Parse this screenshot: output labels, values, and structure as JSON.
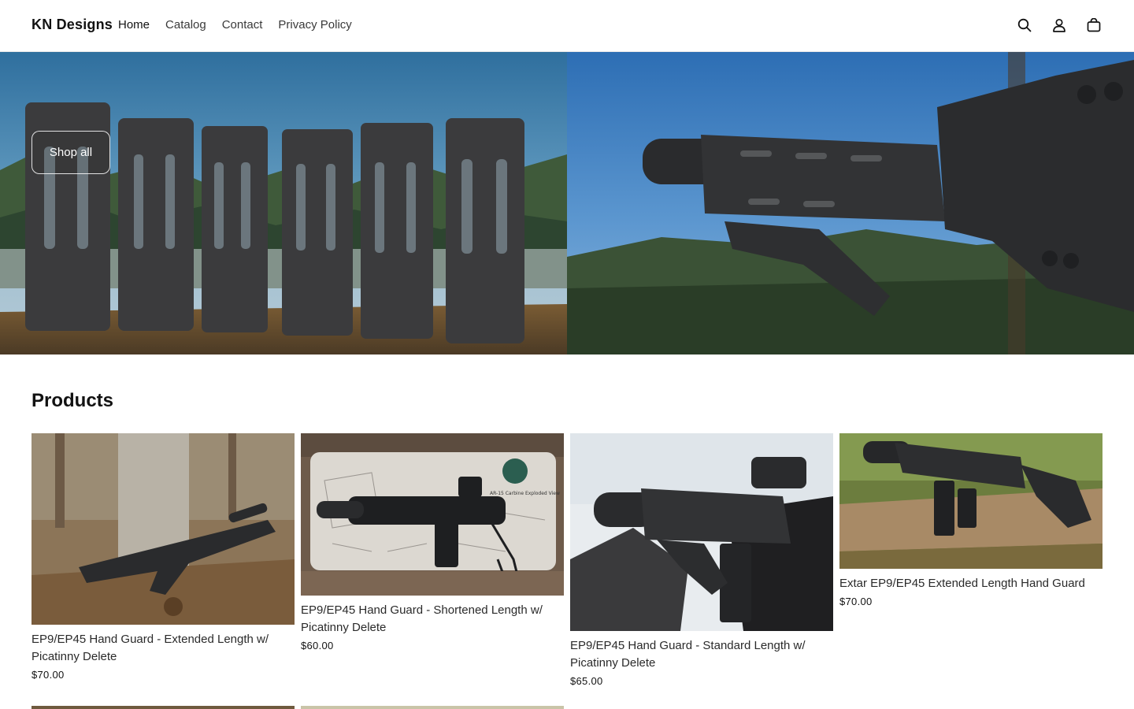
{
  "header": {
    "brand": "KN Designs",
    "nav": [
      {
        "label": "Home",
        "active": true
      },
      {
        "label": "Catalog"
      },
      {
        "label": "Contact"
      },
      {
        "label": "Privacy Policy"
      }
    ],
    "icons": [
      "search-icon",
      "account-icon",
      "cart-icon"
    ]
  },
  "hero": {
    "button": "Shop all"
  },
  "products": {
    "title": "Products",
    "items": [
      {
        "title": "EP9/EP45 Hand Guard - Extended Length w/ Picatinny Delete",
        "price": "$70.00"
      },
      {
        "title": "EP9/EP45 Hand Guard - Shortened Length w/ Picatinny Delete",
        "price": "$60.00"
      },
      {
        "title": "EP9/EP45 Hand Guard - Standard Length w/ Picatinny Delete",
        "price": "$65.00"
      },
      {
        "title": "Extar EP9/EP45 Extended Length Hand Guard",
        "price": "$70.00"
      }
    ]
  }
}
